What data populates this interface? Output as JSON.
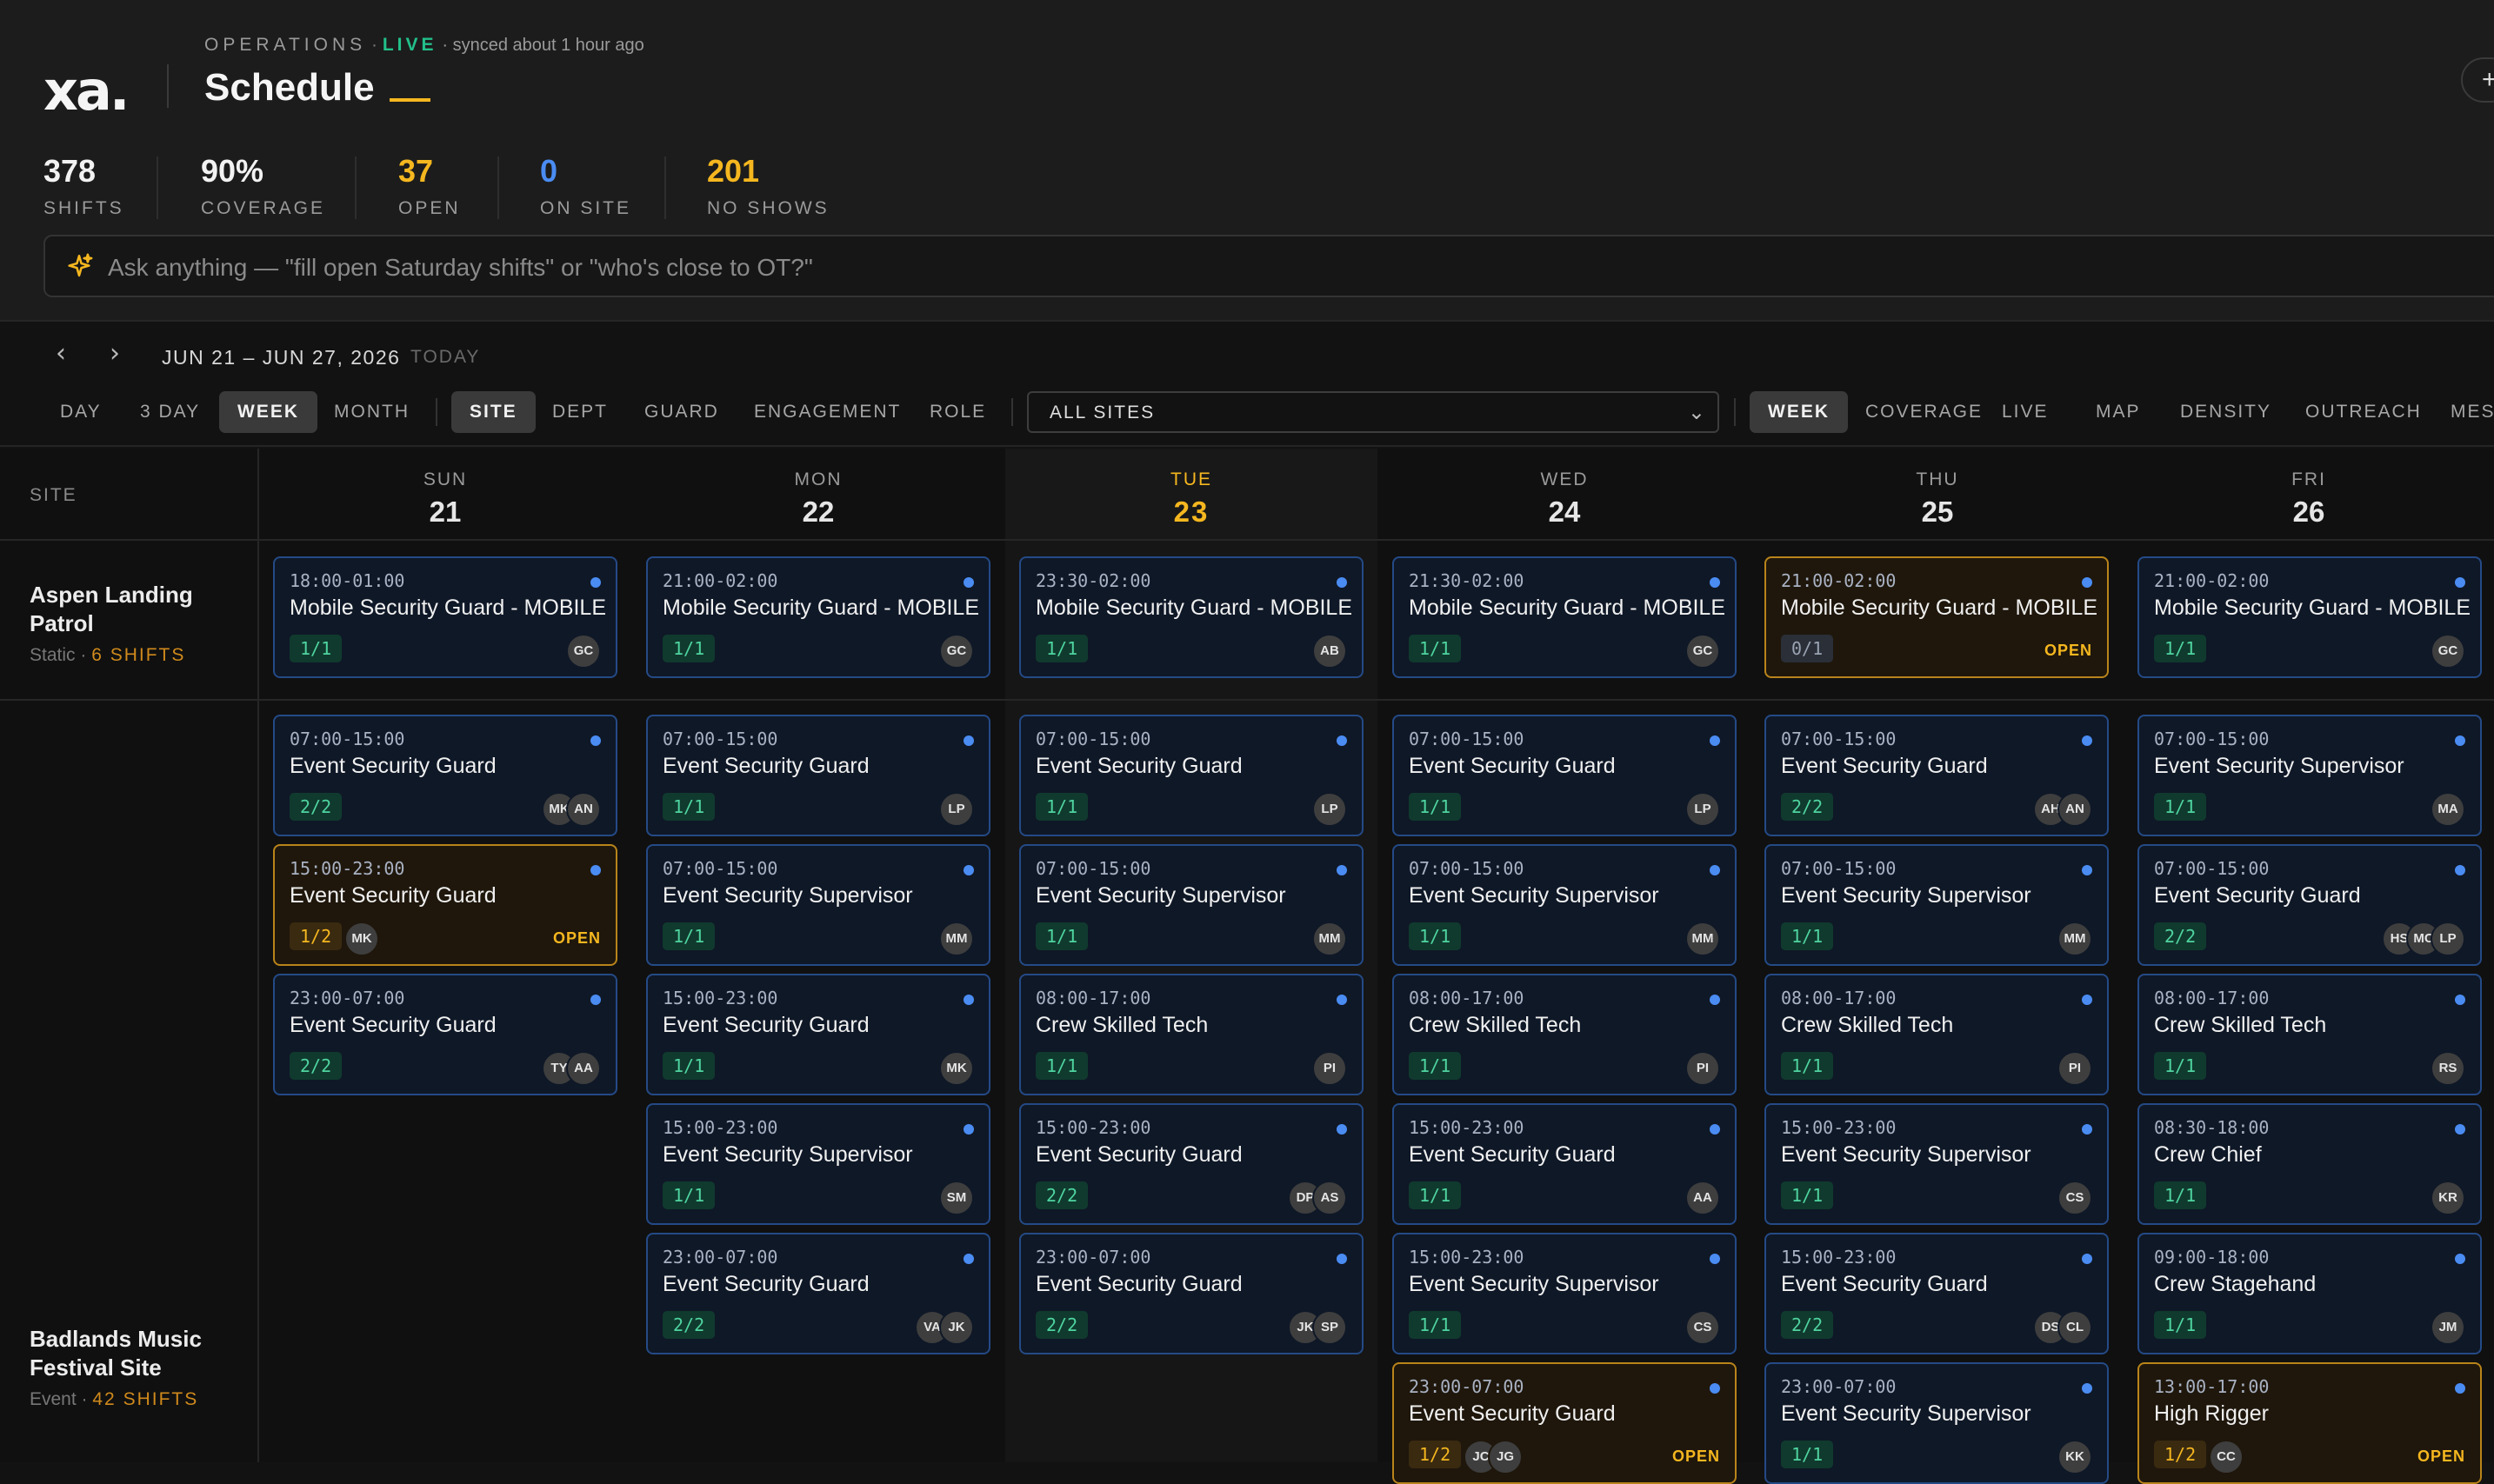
{
  "app": {
    "logo": "xa.",
    "section": "OPERATIONS",
    "sep": "·",
    "live": "LIVE",
    "synced": "· synced about 1 hour ago",
    "title": "Schedule",
    "edge_button": "+"
  },
  "stats": [
    {
      "value": "378",
      "label": "SHIFTS",
      "color": "#f2f2f2"
    },
    {
      "value": "90%",
      "label": "COVERAGE",
      "color": "#f2f2f2"
    },
    {
      "value": "37",
      "label": "OPEN",
      "color": "#f5b71f"
    },
    {
      "value": "0",
      "label": "ON SITE",
      "color": "#4a8cf2"
    },
    {
      "value": "201",
      "label": "NO SHOWS",
      "color": "#f5b71f"
    }
  ],
  "ask": {
    "placeholder": "Ask anything — \"fill open Saturday shifts\" or \"who's close to OT?\"",
    "icon": "sparkle-icon"
  },
  "date_nav": {
    "range": "JUN 21 – JUN 27, 2026",
    "today": "TODAY",
    "prev_icon": "chevron-left-icon",
    "next_icon": "chevron-right-icon"
  },
  "view_tabs": [
    "DAY",
    "3 DAY",
    "WEEK",
    "MONTH"
  ],
  "view_active": "WEEK",
  "group_tabs": [
    "SITE",
    "DEPT",
    "GUARD",
    "ENGAGEMENT",
    "ROLE"
  ],
  "group_active": "SITE",
  "site_filter": "ALL SITES",
  "mode_tabs": [
    "WEEK",
    "COVERAGE",
    "LIVE",
    "MAP",
    "DENSITY",
    "OUTREACH",
    "MES"
  ],
  "mode_active": "WEEK",
  "grid": {
    "site_header": "SITE",
    "days": [
      {
        "dow": "SUN",
        "num": "21",
        "today": false
      },
      {
        "dow": "MON",
        "num": "22",
        "today": false
      },
      {
        "dow": "TUE",
        "num": "23",
        "today": true
      },
      {
        "dow": "WED",
        "num": "24",
        "today": false
      },
      {
        "dow": "THU",
        "num": "25",
        "today": false
      },
      {
        "dow": "FRI",
        "num": "26",
        "today": false
      }
    ],
    "sites": [
      {
        "name": "Aspen Landing Patrol",
        "type": "Static",
        "count": "6 SHIFTS"
      },
      {
        "name": "Badlands Music Festival Site",
        "type": "Event",
        "count": "42 SHIFTS"
      }
    ],
    "row1": [
      [
        {
          "time": "18:00-01:00",
          "role": "Mobile Security Guard - MOBILE",
          "fill": "1/1",
          "avatars": [
            "GC"
          ],
          "open": false
        }
      ],
      [
        {
          "time": "21:00-02:00",
          "role": "Mobile Security Guard - MOBILE",
          "fill": "1/1",
          "avatars": [
            "GC"
          ],
          "open": false
        }
      ],
      [
        {
          "time": "23:30-02:00",
          "role": "Mobile Security Guard - MOBILE",
          "fill": "1/1",
          "avatars": [
            "AB"
          ],
          "open": false
        }
      ],
      [
        {
          "time": "21:30-02:00",
          "role": "Mobile Security Guard - MOBILE",
          "fill": "1/1",
          "avatars": [
            "GC"
          ],
          "open": false
        }
      ],
      [
        {
          "time": "21:00-02:00",
          "role": "Mobile Security Guard - MOBILE",
          "fill": "0/1",
          "avatars": [],
          "open": true,
          "open_label": "OPEN",
          "gray": true
        }
      ],
      [
        {
          "time": "21:00-02:00",
          "role": "Mobile Security Guard - MOBILE",
          "fill": "1/1",
          "avatars": [
            "GC"
          ],
          "open": false
        }
      ]
    ],
    "row2": [
      [
        {
          "time": "07:00-15:00",
          "role": "Event Security Guard",
          "fill": "2/2",
          "avatars": [
            "AN",
            "MK"
          ],
          "open": false
        },
        {
          "time": "15:00-23:00",
          "role": "Event Security Guard",
          "fill": "1/2",
          "avatars": [
            "MK"
          ],
          "open": true,
          "open_label": "OPEN"
        },
        {
          "time": "23:00-07:00",
          "role": "Event Security Guard",
          "fill": "2/2",
          "avatars": [
            "AA",
            "TY"
          ],
          "open": false
        }
      ],
      [
        {
          "time": "07:00-15:00",
          "role": "Event Security Guard",
          "fill": "1/1",
          "avatars": [
            "LP"
          ],
          "open": false
        },
        {
          "time": "07:00-15:00",
          "role": "Event Security Supervisor",
          "fill": "1/1",
          "avatars": [
            "MM"
          ],
          "open": false
        },
        {
          "time": "15:00-23:00",
          "role": "Event Security Guard",
          "fill": "1/1",
          "avatars": [
            "MK"
          ],
          "open": false
        },
        {
          "time": "15:00-23:00",
          "role": "Event Security Supervisor",
          "fill": "1/1",
          "avatars": [
            "SM"
          ],
          "open": false
        },
        {
          "time": "23:00-07:00",
          "role": "Event Security Guard",
          "fill": "2/2",
          "avatars": [
            "JK",
            "VA"
          ],
          "open": false
        }
      ],
      [
        {
          "time": "07:00-15:00",
          "role": "Event Security Guard",
          "fill": "1/1",
          "avatars": [
            "LP"
          ],
          "open": false
        },
        {
          "time": "07:00-15:00",
          "role": "Event Security Supervisor",
          "fill": "1/1",
          "avatars": [
            "MM"
          ],
          "open": false
        },
        {
          "time": "08:00-17:00",
          "role": "Crew Skilled Tech",
          "fill": "1/1",
          "avatars": [
            "PI"
          ],
          "open": false
        },
        {
          "time": "15:00-23:00",
          "role": "Event Security Guard",
          "fill": "2/2",
          "avatars": [
            "AS",
            "DP"
          ],
          "open": false
        },
        {
          "time": "23:00-07:00",
          "role": "Event Security Guard",
          "fill": "2/2",
          "avatars": [
            "SP",
            "JK"
          ],
          "open": false
        }
      ],
      [
        {
          "time": "07:00-15:00",
          "role": "Event Security Guard",
          "fill": "1/1",
          "avatars": [
            "LP"
          ],
          "open": false
        },
        {
          "time": "07:00-15:00",
          "role": "Event Security Supervisor",
          "fill": "1/1",
          "avatars": [
            "MM"
          ],
          "open": false
        },
        {
          "time": "08:00-17:00",
          "role": "Crew Skilled Tech",
          "fill": "1/1",
          "avatars": [
            "PI"
          ],
          "open": false
        },
        {
          "time": "15:00-23:00",
          "role": "Event Security Guard",
          "fill": "1/1",
          "avatars": [
            "AA"
          ],
          "open": false
        },
        {
          "time": "15:00-23:00",
          "role": "Event Security Supervisor",
          "fill": "1/1",
          "avatars": [
            "CS"
          ],
          "open": false
        },
        {
          "time": "23:00-07:00",
          "role": "Event Security Guard",
          "fill": "1/2",
          "avatars": [
            "JC",
            "JG"
          ],
          "open": true,
          "open_label": "OPEN"
        }
      ],
      [
        {
          "time": "07:00-15:00",
          "role": "Event Security Guard",
          "fill": "2/2",
          "avatars": [
            "AN",
            "AH"
          ],
          "open": false
        },
        {
          "time": "07:00-15:00",
          "role": "Event Security Supervisor",
          "fill": "1/1",
          "avatars": [
            "MM"
          ],
          "open": false
        },
        {
          "time": "08:00-17:00",
          "role": "Crew Skilled Tech",
          "fill": "1/1",
          "avatars": [
            "PI"
          ],
          "open": false
        },
        {
          "time": "15:00-23:00",
          "role": "Event Security Supervisor",
          "fill": "1/1",
          "avatars": [
            "CS"
          ],
          "open": false
        },
        {
          "time": "15:00-23:00",
          "role": "Event Security Guard",
          "fill": "2/2",
          "avatars": [
            "CL",
            "DS"
          ],
          "open": false
        },
        {
          "time": "23:00-07:00",
          "role": "Event Security Supervisor",
          "fill": "1/1",
          "avatars": [
            "KK"
          ],
          "open": false
        }
      ],
      [
        {
          "time": "07:00-15:00",
          "role": "Event Security Supervisor",
          "fill": "1/1",
          "avatars": [
            "MA"
          ],
          "open": false
        },
        {
          "time": "07:00-15:00",
          "role": "Event Security Guard",
          "fill": "2/2",
          "avatars": [
            "LP",
            "MC",
            "HS"
          ],
          "open": false
        },
        {
          "time": "08:00-17:00",
          "role": "Crew Skilled Tech",
          "fill": "1/1",
          "avatars": [
            "RS"
          ],
          "open": false
        },
        {
          "time": "08:30-18:00",
          "role": "Crew Chief",
          "fill": "1/1",
          "avatars": [
            "KR"
          ],
          "open": false
        },
        {
          "time": "09:00-18:00",
          "role": "Crew Stagehand",
          "fill": "1/1",
          "avatars": [
            "JM"
          ],
          "open": false
        },
        {
          "time": "13:00-17:00",
          "role": "High Rigger",
          "fill": "1/2",
          "avatars": [
            "CC"
          ],
          "open": true,
          "open_label": "OPEN"
        }
      ]
    ]
  }
}
